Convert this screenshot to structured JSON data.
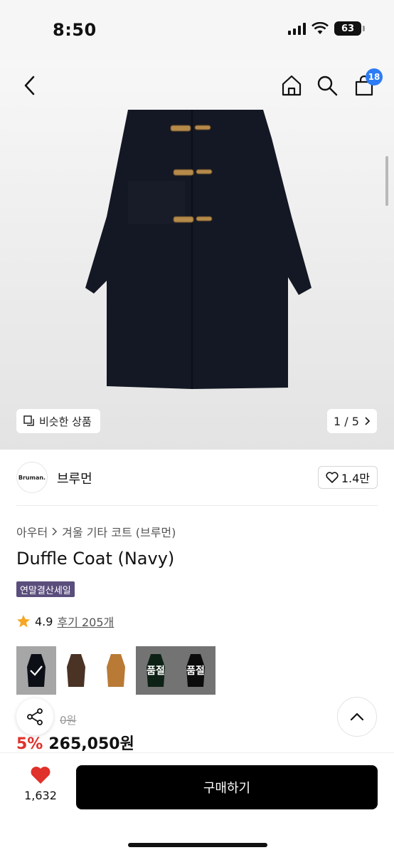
{
  "status": {
    "time": "8:50",
    "battery": "63"
  },
  "nav": {
    "cart_count": "18"
  },
  "hero": {
    "similar_label": "비슷한 상품",
    "page_indicator": "1 / 5"
  },
  "seller": {
    "logo_text": "Bruman.",
    "name": "브루먼",
    "likes": "1.4만"
  },
  "breadcrumb": {
    "level1": "아우터",
    "level2": "겨울 기타 코트 (브루먼)"
  },
  "product": {
    "title": "Duffle Coat (Navy)",
    "tag": "연말결산세일",
    "rating": "4.9",
    "reviews": "후기 205개",
    "original_price": "0원",
    "discount": "5%",
    "price": "265,050원"
  },
  "variants": [
    {
      "color": "navy",
      "status": "selected"
    },
    {
      "color": "brown",
      "status": ""
    },
    {
      "color": "camel",
      "status": ""
    },
    {
      "color": "green",
      "status": "품절"
    },
    {
      "color": "black",
      "status": "품절"
    }
  ],
  "bottom": {
    "wish_count": "1,632",
    "buy_label": "구매하기"
  },
  "colors": {
    "accent": "#2d7cf6",
    "discount": "#e0312a",
    "tag_bg": "#5a4e7c",
    "buy_bg": "#000000"
  }
}
